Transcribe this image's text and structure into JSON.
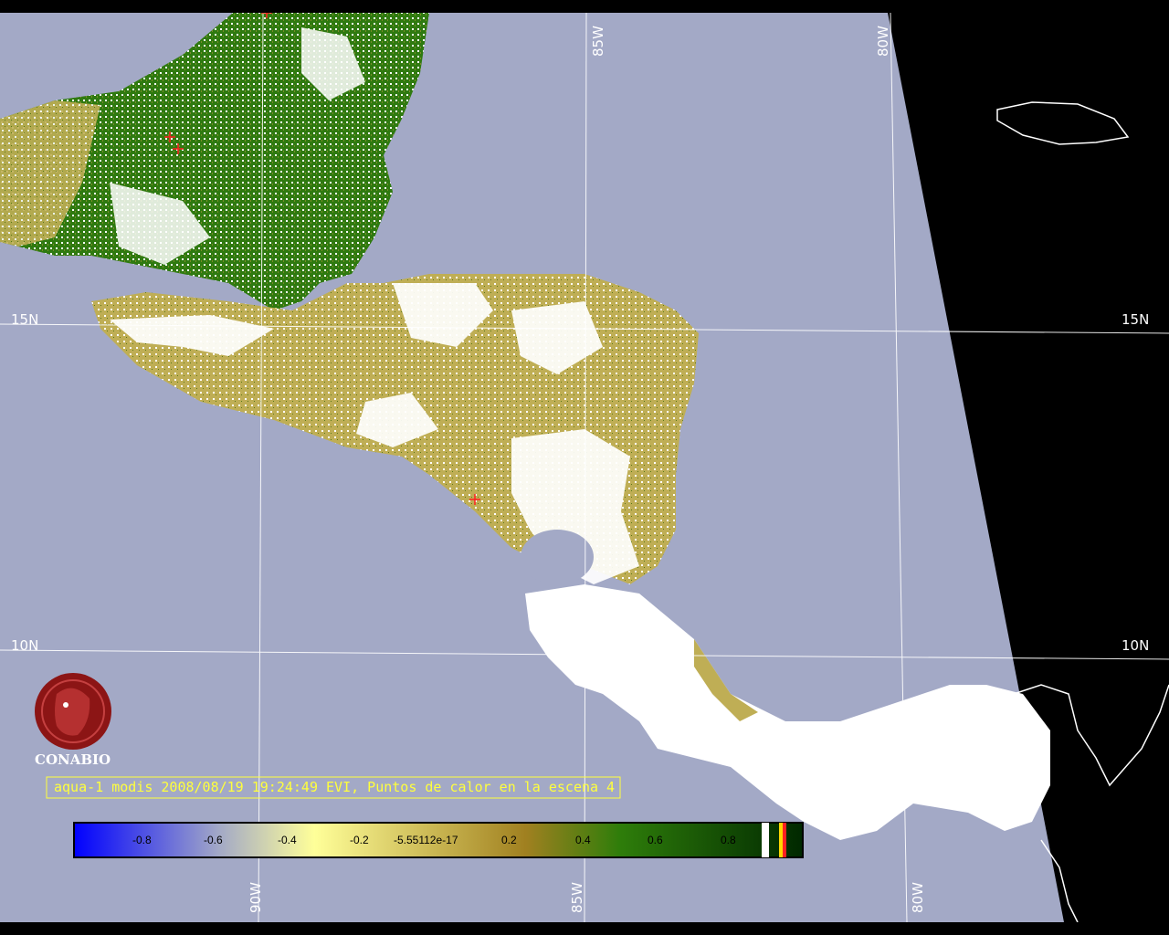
{
  "map": {
    "latitude_labels": [
      "15N",
      "15N",
      "10N",
      "10N"
    ],
    "longitude_labels_top": [
      "85W",
      "80W"
    ],
    "longitude_labels_bottom": [
      "90W",
      "85W",
      "80W"
    ]
  },
  "logo": {
    "name": "CONABIO"
  },
  "caption": {
    "text": "aqua-1 modis 2008/08/19 19:24:49 EVI, Puntos de calor en la escena 4"
  },
  "colorbar": {
    "ticks": [
      "-0.8",
      "-0.6",
      "-0.4",
      "-0.2",
      "-5.55112e-17",
      "0.2",
      "0.4",
      "0.6",
      "0.8"
    ],
    "colors": [
      "#0000ff",
      "#a3a9c6",
      "#ffff99",
      "#c8b450",
      "#b09030",
      "#2e7d0a",
      "#003a00"
    ]
  },
  "colors": {
    "ocean": "#a3a9c6",
    "space": "#000000",
    "vegetation_dense": "#2f7a10",
    "vegetation_mid": "#b8a848",
    "cloud": "#ffffff",
    "caption": "#ffff3c",
    "hotspot": "#ff2020",
    "logo": "#8c1515"
  },
  "hotspots_count": 4
}
